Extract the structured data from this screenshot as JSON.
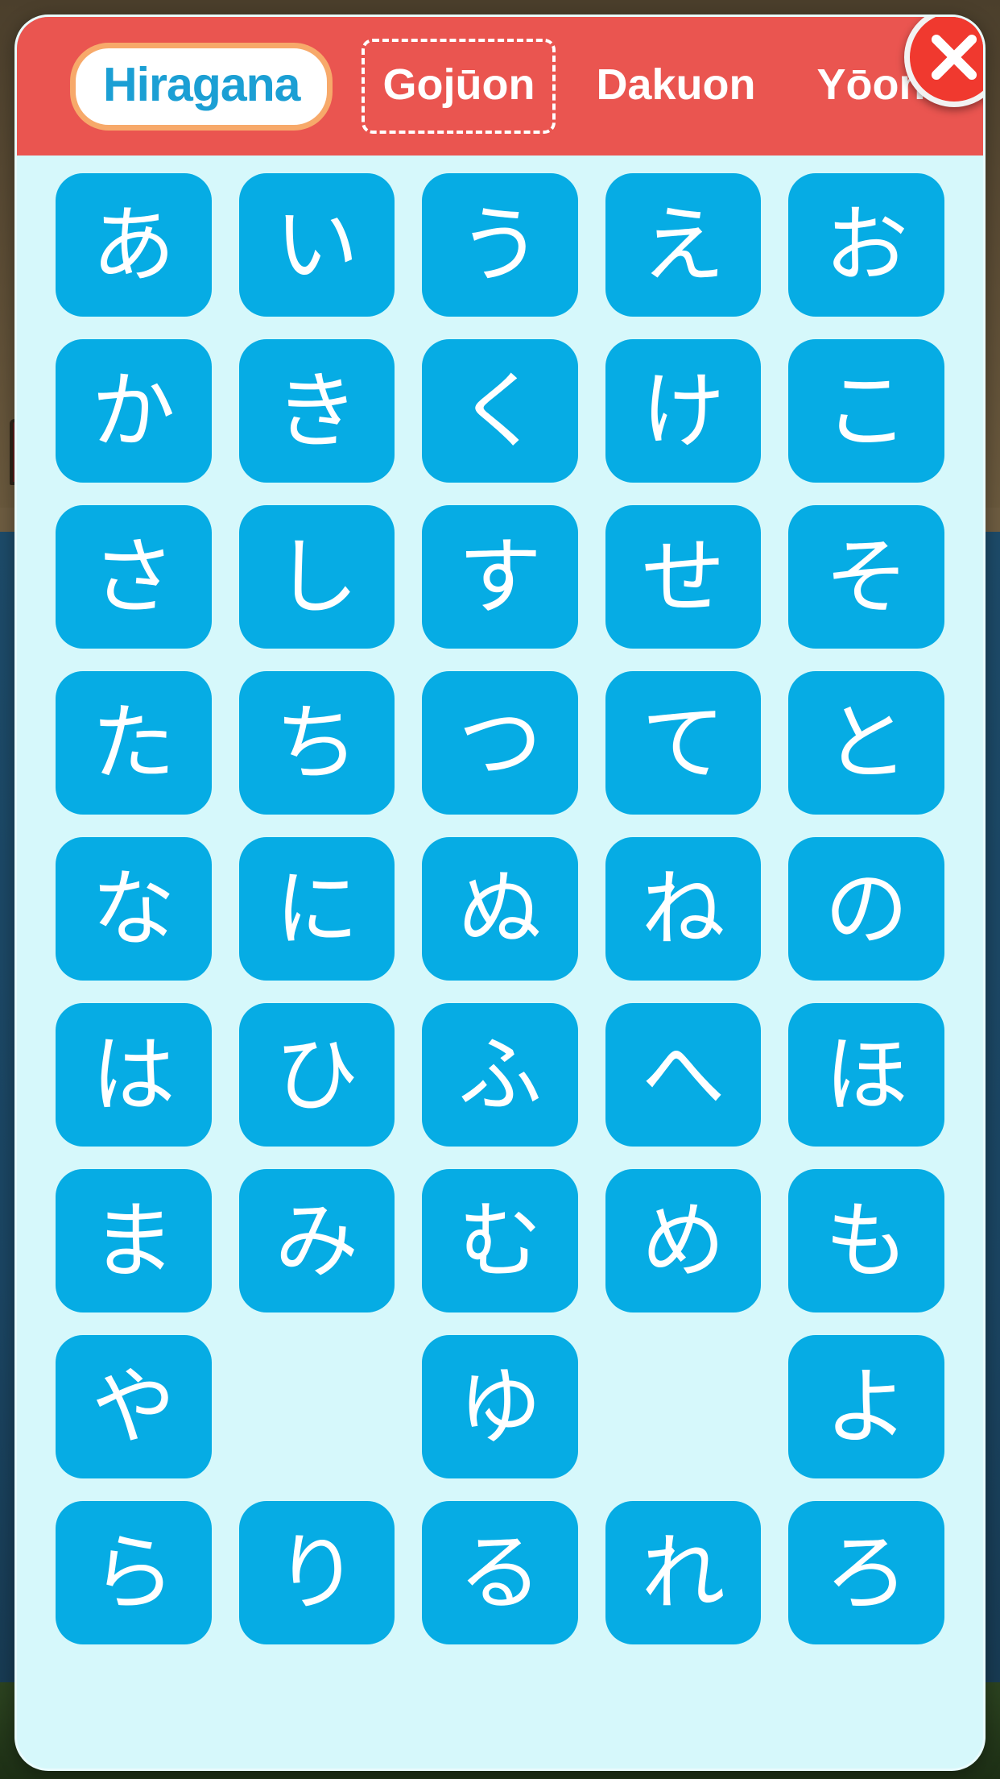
{
  "colors": {
    "header_bg": "#ea5550",
    "panel_bg": "#d6f8fb",
    "tile_bg": "#06ace4",
    "tile_text": "#ffffff",
    "pill_bg": "#ffffff",
    "pill_border": "#f7a96a",
    "pill_text": "#1b9fd4",
    "close_bg": "#f0392f",
    "close_ring": "#f2f2f2"
  },
  "header": {
    "script_label": "Hiragana",
    "tabs": [
      {
        "label": "Gojūon",
        "selected": true
      },
      {
        "label": "Dakuon",
        "selected": false
      },
      {
        "label": "Yōon",
        "selected": false
      }
    ],
    "close_icon": "close-x-icon"
  },
  "grid": {
    "columns": 5,
    "rows": [
      [
        "あ",
        "い",
        "う",
        "え",
        "お"
      ],
      [
        "か",
        "き",
        "く",
        "け",
        "こ"
      ],
      [
        "さ",
        "し",
        "す",
        "せ",
        "そ"
      ],
      [
        "た",
        "ち",
        "つ",
        "て",
        "と"
      ],
      [
        "な",
        "に",
        "ぬ",
        "ね",
        "の"
      ],
      [
        "は",
        "ひ",
        "ふ",
        "へ",
        "ほ"
      ],
      [
        "ま",
        "み",
        "む",
        "め",
        "も"
      ],
      [
        "や",
        "",
        "ゆ",
        "",
        "よ"
      ],
      [
        "ら",
        "り",
        "る",
        "れ",
        "ろ"
      ]
    ]
  }
}
